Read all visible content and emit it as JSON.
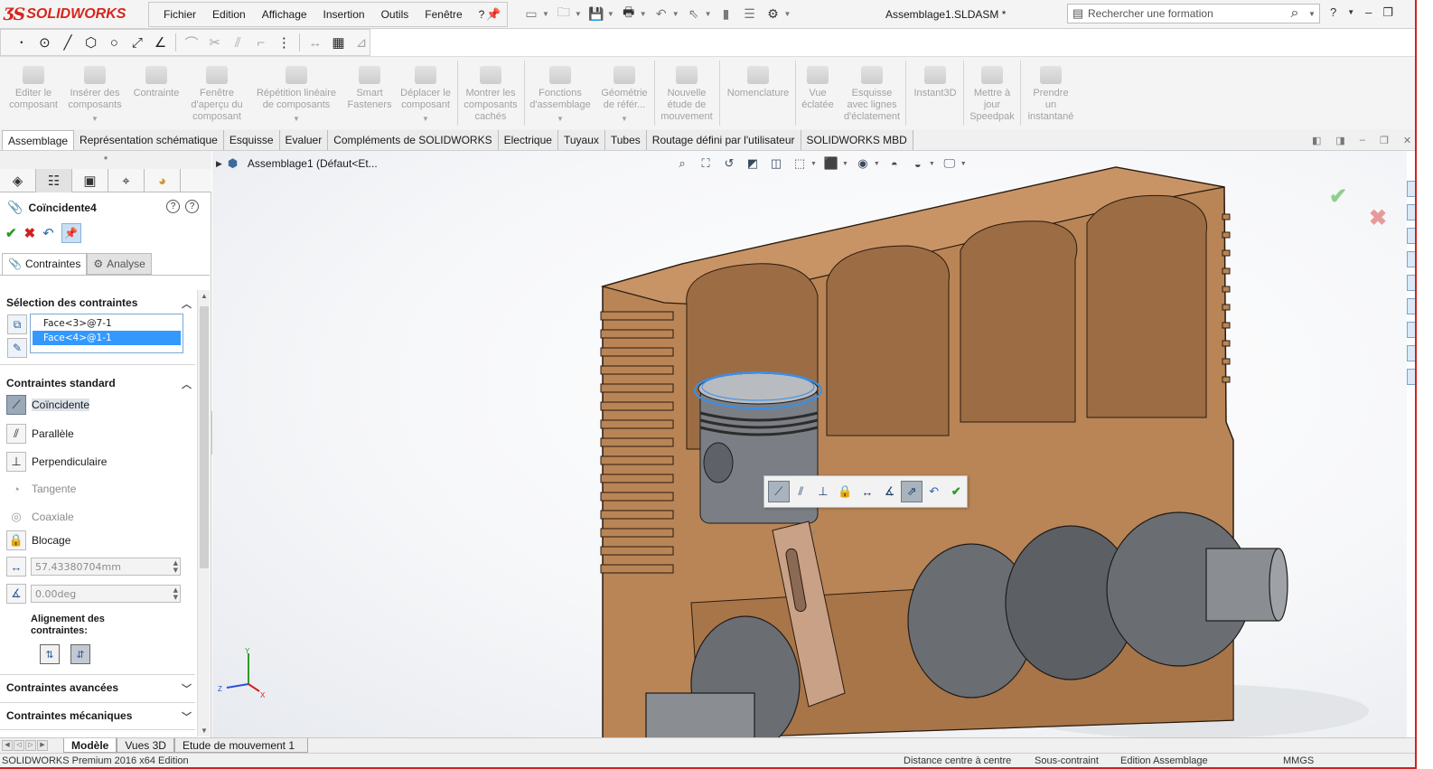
{
  "app": {
    "logo_text": "SOLIDWORKS",
    "document_title": "Assemblage1.SLDASM *",
    "brand_color": "#d6261d"
  },
  "menu": {
    "items": [
      "Fichier",
      "Edition",
      "Affichage",
      "Insertion",
      "Outils",
      "Fenêtre",
      "?"
    ]
  },
  "search": {
    "placeholder": "Rechercher une formation"
  },
  "command_manager": {
    "commands": [
      {
        "label": "Editer le composant",
        "lines": [
          "Editer le",
          "composant"
        ]
      },
      {
        "label": "Insérer des composants",
        "lines": [
          "Insérer des",
          "composants"
        ]
      },
      {
        "label": "Contrainte",
        "lines": [
          "Contrainte"
        ]
      },
      {
        "label": "Fenêtre d'aperçu du composant",
        "lines": [
          "Fenêtre",
          "d'aperçu du",
          "composant"
        ]
      },
      {
        "label": "Répétition linéaire de composants",
        "lines": [
          "Répétition linéaire",
          "de composants"
        ]
      },
      {
        "label": "Smart Fasteners",
        "lines": [
          "Smart",
          "Fasteners"
        ]
      },
      {
        "label": "Déplacer le composant",
        "lines": [
          "Déplacer le",
          "composant"
        ]
      },
      {
        "label": "Montrer les composants cachés",
        "lines": [
          "Montrer les",
          "composants",
          "cachés"
        ]
      },
      {
        "label": "Fonctions d'assemblage",
        "lines": [
          "Fonctions",
          "d'assemblage"
        ]
      },
      {
        "label": "Géométrie de référence",
        "lines": [
          "Géométrie",
          "de référ..."
        ]
      },
      {
        "label": "Nouvelle étude de mouvement",
        "lines": [
          "Nouvelle",
          "étude de",
          "mouvement"
        ]
      },
      {
        "label": "Nomenclature",
        "lines": [
          "Nomenclature"
        ]
      },
      {
        "label": "Vue éclatée",
        "lines": [
          "Vue",
          "éclatée"
        ]
      },
      {
        "label": "Esquisse avec lignes d'éclatement",
        "lines": [
          "Esquisse",
          "avec lignes",
          "d'éclatement"
        ]
      },
      {
        "label": "Instant3D",
        "lines": [
          "Instant3D"
        ]
      },
      {
        "label": "Mettre à jour Speedpak",
        "lines": [
          "Mettre à",
          "jour",
          "Speedpak"
        ]
      },
      {
        "label": "Prendre un instantané",
        "lines": [
          "Prendre",
          "un",
          "instantané"
        ]
      }
    ]
  },
  "tabs": [
    "Assemblage",
    "Représentation schématique",
    "Esquisse",
    "Evaluer",
    "Compléments de SOLIDWORKS",
    "Electrique",
    "Tuyaux",
    "Tubes",
    "Routage défini par l'utilisateur",
    "SOLIDWORKS MBD"
  ],
  "property_manager": {
    "title": "Coïncidente4",
    "subtabs": {
      "mates": "Contraintes",
      "analysis": "Analyse"
    },
    "selection_group": {
      "title": "Sélection des contraintes",
      "items": [
        "Face<3>@7-1",
        "Face<4>@1-1"
      ]
    },
    "standard_group": {
      "title": "Contraintes standard",
      "mates": [
        {
          "label": "Coïncidente",
          "icon": "coincident-icon"
        },
        {
          "label": "Parallèle",
          "icon": "parallel-icon"
        },
        {
          "label": "Perpendiculaire",
          "icon": "perpendicular-icon"
        },
        {
          "label": "Tangente",
          "icon": "tangent-icon"
        },
        {
          "label": "Coaxiale",
          "icon": "concentric-icon"
        },
        {
          "label": "Blocage",
          "icon": "lock-icon"
        }
      ],
      "distance_value": "57.43380704mm",
      "angle_value": "0.00deg",
      "alignment_label_1": "Alignement des",
      "alignment_label_2": "contraintes:"
    },
    "advanced_group": {
      "title": "Contraintes avancées"
    },
    "mechanical_group": {
      "title": "Contraintes mécaniques"
    }
  },
  "graphics": {
    "tree_node": "Assemblage1  (Défaut<Et..."
  },
  "bottom_tabs": [
    "Modèle",
    "Vues 3D",
    "Etude de mouvement 1"
  ],
  "status": {
    "left": "SOLIDWORKS Premium 2016 x64 Edition",
    "mid1": "Distance centre à centre",
    "mid2": "Sous-contraint",
    "mid3": "Edition Assemblage",
    "units": "MMGS"
  }
}
